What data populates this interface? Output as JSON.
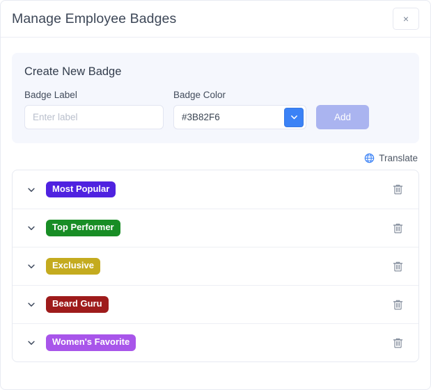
{
  "header": {
    "title": "Manage Employee Badges",
    "close_label": "×"
  },
  "create_panel": {
    "title": "Create New Badge",
    "label_field": {
      "label": "Badge Label",
      "value": "",
      "placeholder": "Enter label"
    },
    "color_field": {
      "label": "Badge Color",
      "value": "#3B82F6",
      "swatch_color": "#3B82F6"
    },
    "add_button": {
      "label": "Add",
      "color": "#AAB4F0"
    }
  },
  "translate": {
    "label": "Translate",
    "icon_color": "#3B82F6"
  },
  "badges": [
    {
      "label": "Most Popular",
      "color": "#4F22E0"
    },
    {
      "label": "Top Performer",
      "color": "#188D25"
    },
    {
      "label": "Exclusive",
      "color": "#C4AB1F"
    },
    {
      "label": "Beard Guru",
      "color": "#9E1B1B"
    },
    {
      "label": "Women's Favorite",
      "color": "#A855EA"
    }
  ]
}
